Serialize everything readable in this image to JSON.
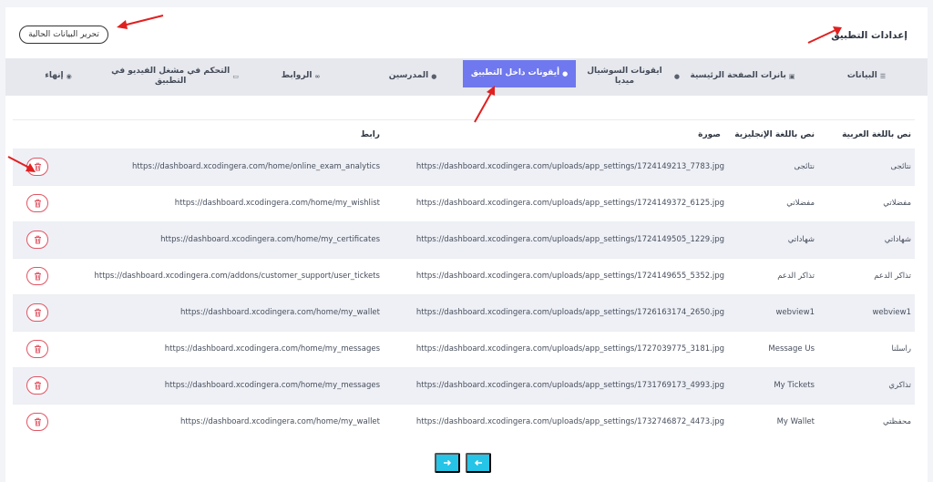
{
  "header": {
    "title": "إعدادات التطبيق",
    "edit_button": "تحرير البيانات الحالية"
  },
  "tabs": [
    {
      "label": "البيانات",
      "icon": "database-icon"
    },
    {
      "label": "بانرات الصفحة الرئيسية",
      "icon": "image-icon"
    },
    {
      "label": "ايقونات السوشيال ميديا",
      "icon": "info-circle-icon"
    },
    {
      "label": "أيقونات داخل التطبيق",
      "icon": "info-circle-icon",
      "active": true
    },
    {
      "label": "المدرسين",
      "icon": "info-circle-icon"
    },
    {
      "label": "الروابط",
      "icon": "link-icon"
    },
    {
      "label": "التحكم في مشغل الفيديو في التطبيق",
      "icon": "video-icon"
    },
    {
      "label": "إنهاء",
      "icon": "check-circle-icon"
    }
  ],
  "table": {
    "columns": [
      "نص باللغة العربية",
      "نص باللغة الإنجليزية",
      "صورة",
      "رابط"
    ],
    "rows": [
      {
        "ar": "نتائجى",
        "en": "نتائجى",
        "image": "https://dashboard.xcodingera.com/uploads/app_settings/1724149213_7783.jpg",
        "link": "https://dashboard.xcodingera.com/home/online_exam_analytics"
      },
      {
        "ar": "مفضلاتي",
        "en": "مفضلاتي",
        "image": "https://dashboard.xcodingera.com/uploads/app_settings/1724149372_6125.jpg",
        "link": "https://dashboard.xcodingera.com/home/my_wishlist"
      },
      {
        "ar": "شهاداتي",
        "en": "شهاداتي",
        "image": "https://dashboard.xcodingera.com/uploads/app_settings/1724149505_1229.jpg",
        "link": "https://dashboard.xcodingera.com/home/my_certificates"
      },
      {
        "ar": "تذاكر الدعم",
        "en": "تذاكر الدعم",
        "image": "https://dashboard.xcodingera.com/uploads/app_settings/1724149655_5352.jpg",
        "link": "https://dashboard.xcodingera.com/addons/customer_support/user_tickets"
      },
      {
        "ar": "webview1",
        "en": "webview1",
        "image": "https://dashboard.xcodingera.com/uploads/app_settings/1726163174_2650.jpg",
        "link": "https://dashboard.xcodingera.com/home/my_wallet"
      },
      {
        "ar": "راسلنا",
        "en": "Message Us",
        "image": "https://dashboard.xcodingera.com/uploads/app_settings/1727039775_3181.jpg",
        "link": "https://dashboard.xcodingera.com/home/my_messages"
      },
      {
        "ar": "تذاكري",
        "en": "My Tickets",
        "image": "https://dashboard.xcodingera.com/uploads/app_settings/1731769173_4993.jpg",
        "link": "https://dashboard.xcodingera.com/home/my_messages"
      },
      {
        "ar": "محفظتي",
        "en": "My Wallet",
        "image": "https://dashboard.xcodingera.com/uploads/app_settings/1732746872_4473.jpg",
        "link": "https://dashboard.xcodingera.com/home/my_wallet"
      }
    ]
  },
  "pagination": {
    "next_icon": "arrow-right-icon",
    "prev_icon": "arrow-left-icon"
  },
  "colors": {
    "accent": "#6f78ee",
    "danger": "#e05563",
    "pager": "#26c4e6",
    "annotation": "#e02020"
  }
}
